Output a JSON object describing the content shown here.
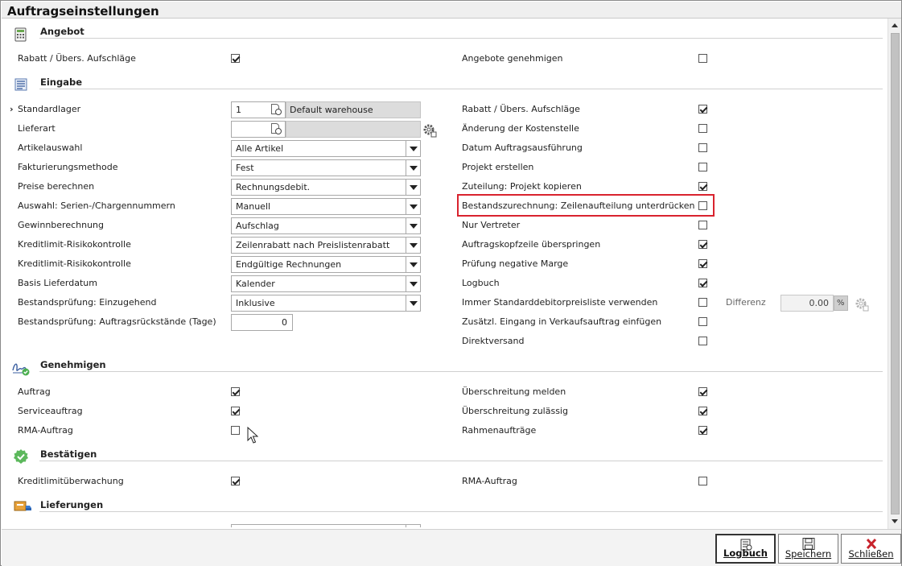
{
  "window": {
    "title": "Auftragseinstellungen"
  },
  "sections": {
    "angebot": {
      "title": "Angebot"
    },
    "eingabe": {
      "title": "Eingabe"
    },
    "genehmigen": {
      "title": "Genehmigen"
    },
    "bestaetigen": {
      "title": "Bestätigen"
    },
    "lieferungen": {
      "title": "Lieferungen"
    }
  },
  "angebot": {
    "left": {
      "label": "Rabatt / Übers. Aufschläge",
      "checked": true
    },
    "right": {
      "label": "Angebote genehmigen",
      "checked": false
    }
  },
  "eingabe": {
    "left": [
      {
        "label": "Standardlager",
        "type": "lookup",
        "value": "1",
        "description": "Default warehouse",
        "marker": "›"
      },
      {
        "label": "Lieferart",
        "type": "lookup",
        "value": "",
        "description": ""
      },
      {
        "label": "Artikelauswahl",
        "type": "select",
        "value": "Alle Artikel"
      },
      {
        "label": "Fakturierungsmethode",
        "type": "select",
        "value": "Fest"
      },
      {
        "label": "Preise berechnen",
        "type": "select",
        "value": "Rechnungsdebit."
      },
      {
        "label": "Auswahl: Serien-/Chargennummern",
        "type": "select",
        "value": "Manuell"
      },
      {
        "label": "Gewinnberechnung",
        "type": "select",
        "value": "Aufschlag"
      },
      {
        "label": "Kreditlimit-Risikokontrolle",
        "type": "select",
        "value": "Zeilenrabatt nach Preislistenrabatt"
      },
      {
        "label": "Kreditlimit-Risikokontrolle",
        "type": "select",
        "value": "Endgültige Rechnungen"
      },
      {
        "label": "Basis Lieferdatum",
        "type": "select",
        "value": "Kalender"
      },
      {
        "label": "Bestandsprüfung: Einzugehend",
        "type": "select",
        "value": "Inklusive"
      },
      {
        "label": "Bestandsprüfung: Auftragsrückstände (Tage)",
        "type": "number",
        "value": "0"
      }
    ],
    "right": [
      {
        "label": "Rabatt / Übers. Aufschläge",
        "checked": true
      },
      {
        "label": "Änderung der Kostenstelle",
        "checked": false
      },
      {
        "label": "Datum Auftragsausführung",
        "checked": false
      },
      {
        "label": "Projekt erstellen",
        "checked": false
      },
      {
        "label": "Zuteilung: Projekt kopieren",
        "checked": true
      },
      {
        "label": "Bestandszurechnung: Zeilenaufteilung unterdrücken",
        "checked": false
      },
      {
        "label": "Nur Vertreter",
        "checked": false
      },
      {
        "label": "Auftragskopfzeile überspringen",
        "checked": true
      },
      {
        "label": "Prüfung negative Marge",
        "checked": true
      },
      {
        "label": "Logbuch",
        "checked": true
      },
      {
        "label": "Immer Standarddebitorpreisliste verwenden",
        "checked": false
      },
      {
        "label": "Zusätzl. Eingang in Verkaufsauftrag einfügen",
        "checked": false
      },
      {
        "label": "Direktversand",
        "checked": false
      }
    ],
    "differenz": {
      "label": "Differenz",
      "value": "0.00",
      "unit": "%"
    }
  },
  "genehmigen": {
    "left": [
      {
        "label": "Auftrag",
        "checked": true
      },
      {
        "label": "Serviceauftrag",
        "checked": true
      },
      {
        "label": "RMA-Auftrag",
        "checked": false
      }
    ],
    "right": [
      {
        "label": "Überschreitung melden",
        "checked": true
      },
      {
        "label": "Überschreitung zulässig",
        "checked": true
      },
      {
        "label": "Rahmenaufträge",
        "checked": true
      }
    ]
  },
  "bestaetigen": {
    "left": {
      "label": "Kreditlimitüberwachung",
      "checked": true
    },
    "right": {
      "label": "RMA-Auftrag",
      "checked": false
    }
  },
  "footer": {
    "logbuch": "Logbuch",
    "speichern": "Speichern",
    "schliessen": "Schließen"
  },
  "colors": {
    "highlight": "#d9232e",
    "close_icon": "#c8232c",
    "check_green": "#4caf50"
  }
}
